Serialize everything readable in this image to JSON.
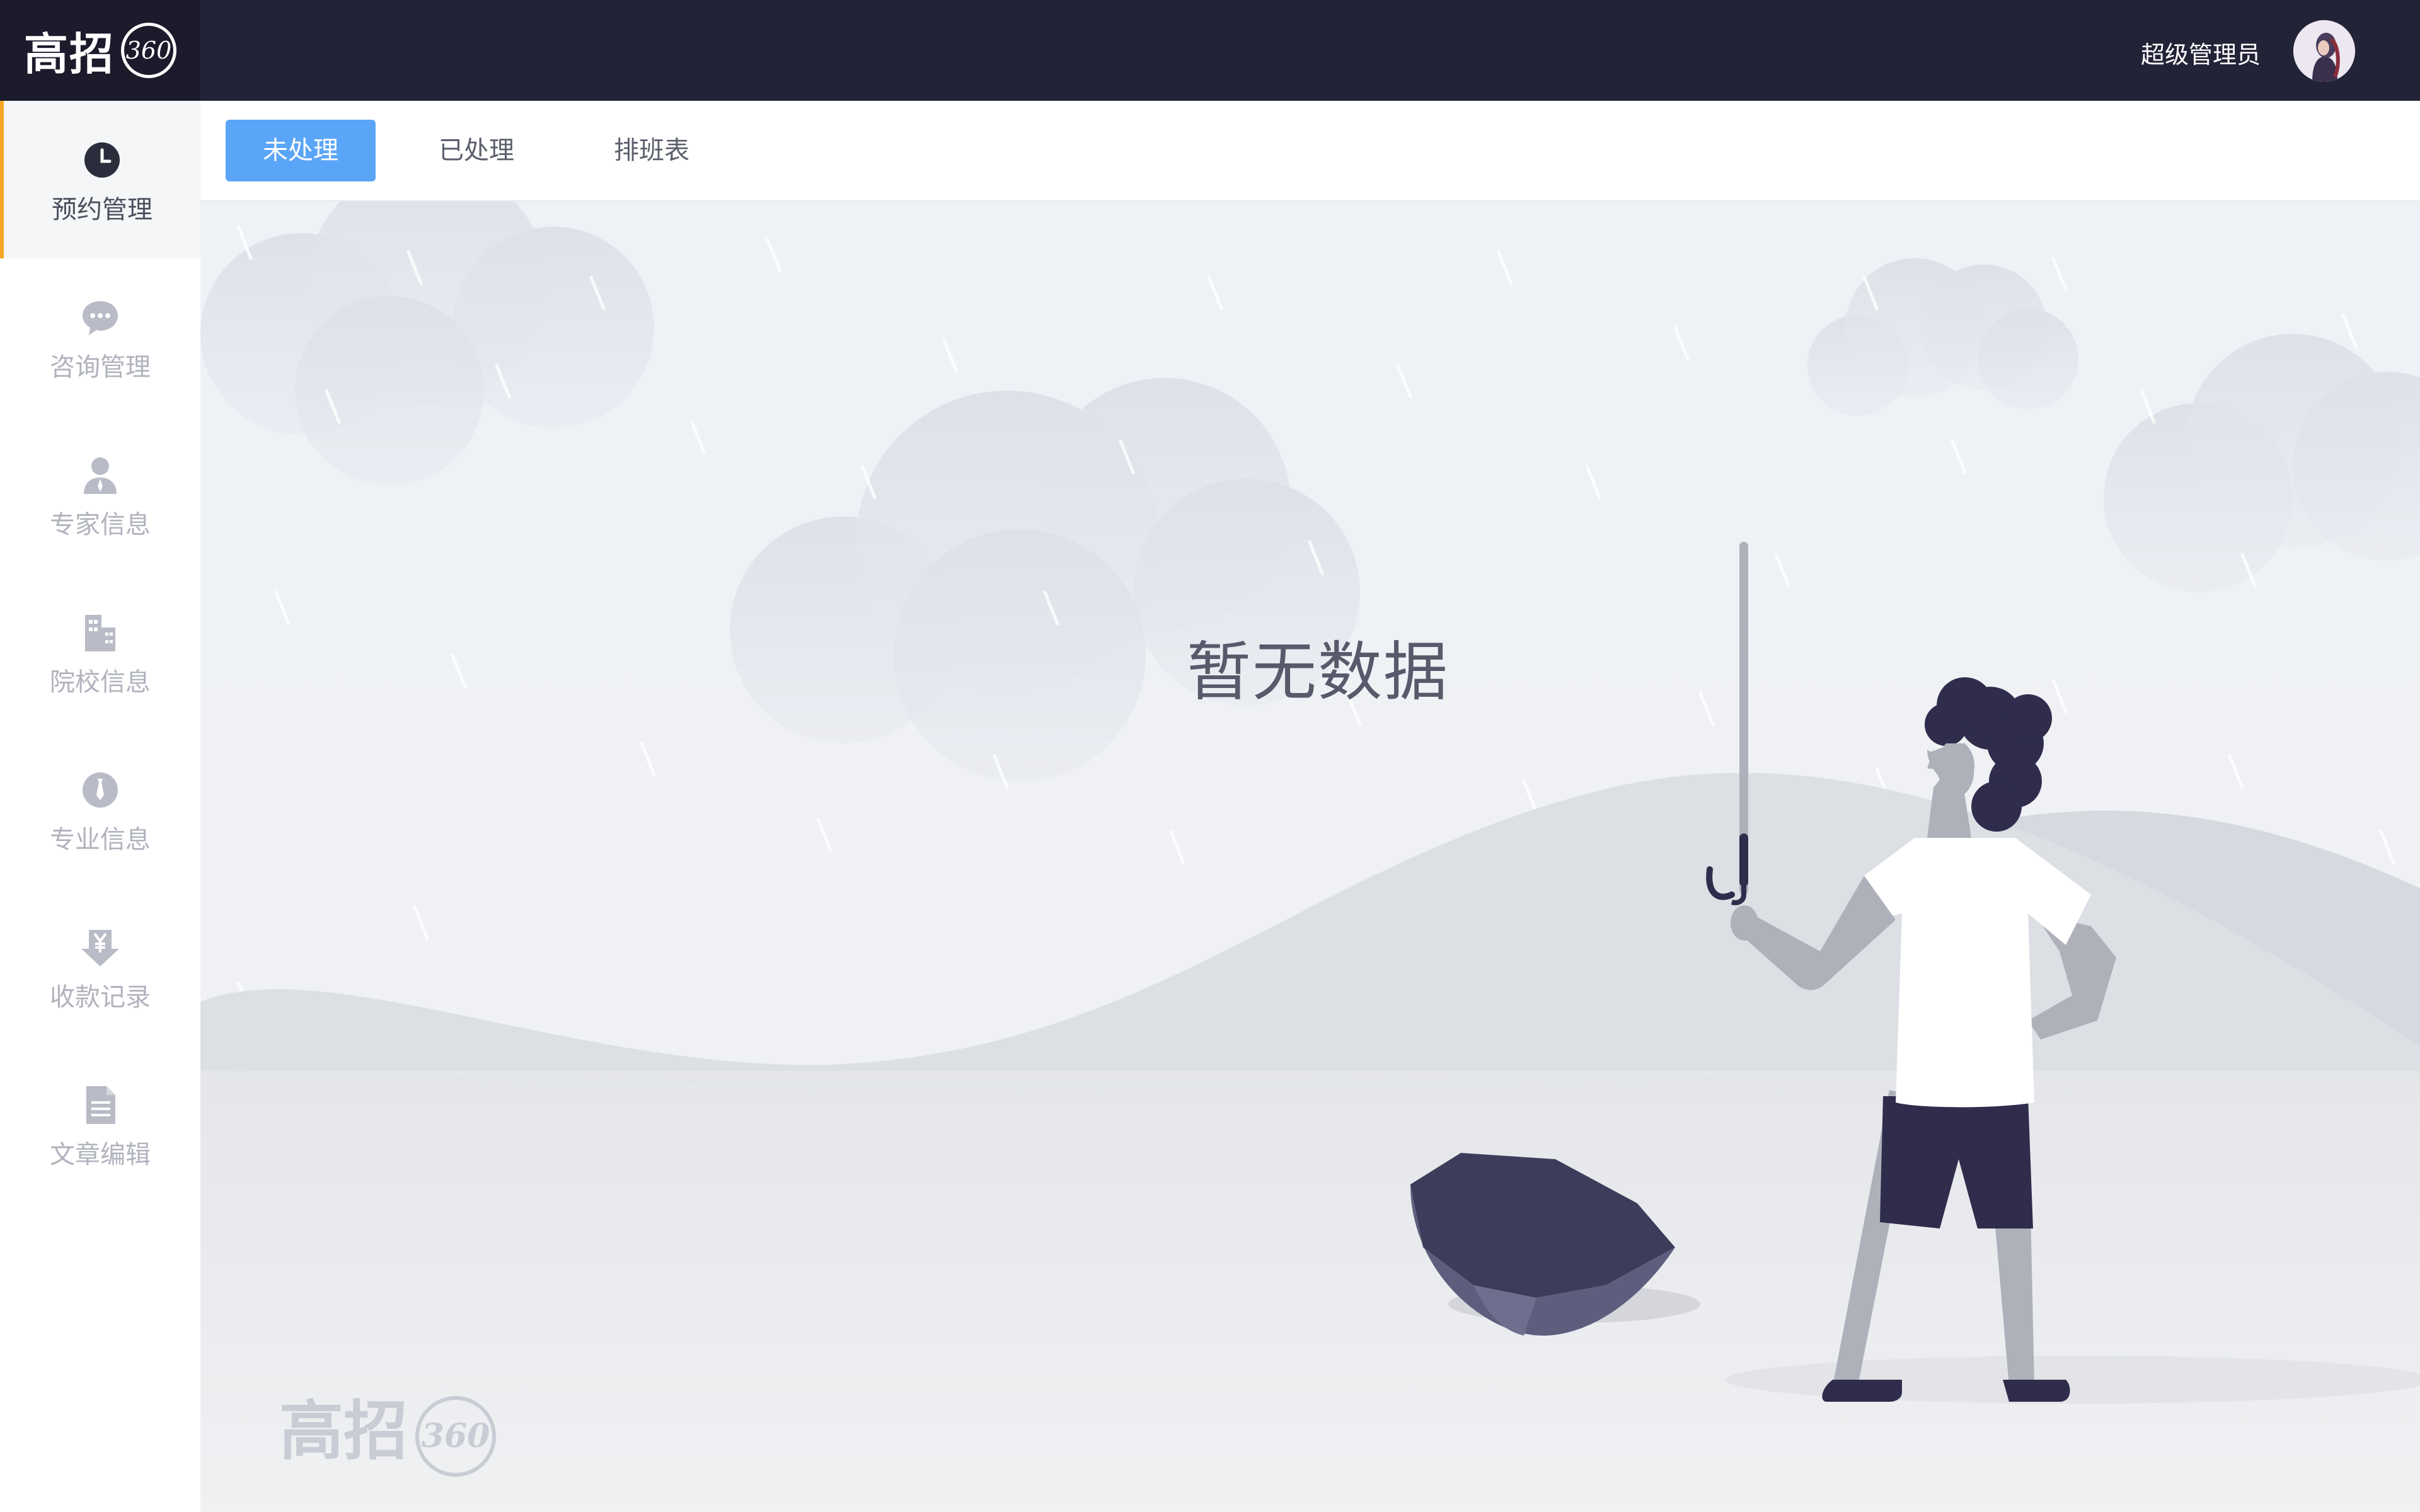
{
  "header": {
    "logo_text": "高招",
    "logo_badge": "360",
    "user_name": "超级管理员"
  },
  "sidebar": {
    "items": [
      {
        "label": "预约管理",
        "icon": "clock-icon",
        "active": true
      },
      {
        "label": "咨询管理",
        "icon": "chat-bubble-icon",
        "active": false
      },
      {
        "label": "专家信息",
        "icon": "person-icon",
        "active": false
      },
      {
        "label": "院校信息",
        "icon": "building-icon",
        "active": false
      },
      {
        "label": "专业信息",
        "icon": "tie-icon",
        "active": false
      },
      {
        "label": "收款记录",
        "icon": "yuan-download-icon",
        "active": false
      },
      {
        "label": "文章编辑",
        "icon": "document-icon",
        "active": false
      }
    ]
  },
  "tabs": [
    {
      "label": "未处理",
      "active": true
    },
    {
      "label": "已处理",
      "active": false
    },
    {
      "label": "排班表",
      "active": false
    }
  ],
  "main": {
    "empty_text": "暂无数据",
    "watermark_text": "高招",
    "watermark_badge": "360"
  },
  "colors": {
    "header_bg": "#232338",
    "accent": "#5aa5f7",
    "active_marker": "#f5a623"
  }
}
